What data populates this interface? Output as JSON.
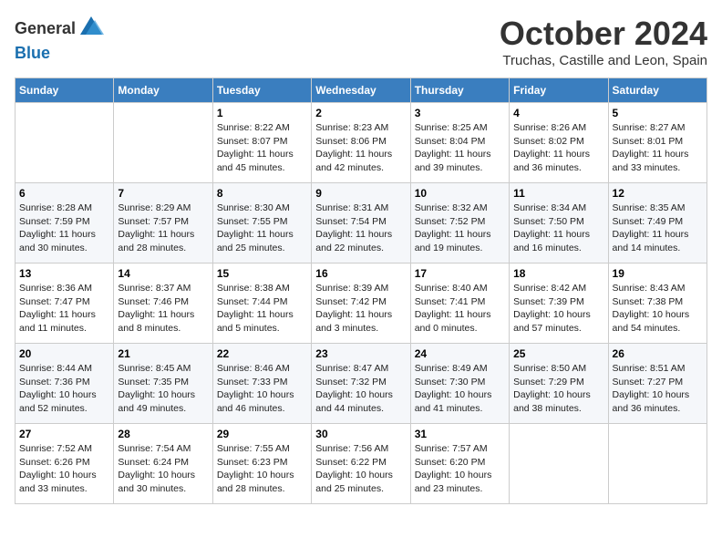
{
  "header": {
    "logo_line1": "General",
    "logo_line2": "Blue",
    "month": "October 2024",
    "location": "Truchas, Castille and Leon, Spain"
  },
  "days_of_week": [
    "Sunday",
    "Monday",
    "Tuesday",
    "Wednesday",
    "Thursday",
    "Friday",
    "Saturday"
  ],
  "weeks": [
    [
      {
        "day": "",
        "info": ""
      },
      {
        "day": "",
        "info": ""
      },
      {
        "day": "1",
        "info": "Sunrise: 8:22 AM\nSunset: 8:07 PM\nDaylight: 11 hours and 45 minutes."
      },
      {
        "day": "2",
        "info": "Sunrise: 8:23 AM\nSunset: 8:06 PM\nDaylight: 11 hours and 42 minutes."
      },
      {
        "day": "3",
        "info": "Sunrise: 8:25 AM\nSunset: 8:04 PM\nDaylight: 11 hours and 39 minutes."
      },
      {
        "day": "4",
        "info": "Sunrise: 8:26 AM\nSunset: 8:02 PM\nDaylight: 11 hours and 36 minutes."
      },
      {
        "day": "5",
        "info": "Sunrise: 8:27 AM\nSunset: 8:01 PM\nDaylight: 11 hours and 33 minutes."
      }
    ],
    [
      {
        "day": "6",
        "info": "Sunrise: 8:28 AM\nSunset: 7:59 PM\nDaylight: 11 hours and 30 minutes."
      },
      {
        "day": "7",
        "info": "Sunrise: 8:29 AM\nSunset: 7:57 PM\nDaylight: 11 hours and 28 minutes."
      },
      {
        "day": "8",
        "info": "Sunrise: 8:30 AM\nSunset: 7:55 PM\nDaylight: 11 hours and 25 minutes."
      },
      {
        "day": "9",
        "info": "Sunrise: 8:31 AM\nSunset: 7:54 PM\nDaylight: 11 hours and 22 minutes."
      },
      {
        "day": "10",
        "info": "Sunrise: 8:32 AM\nSunset: 7:52 PM\nDaylight: 11 hours and 19 minutes."
      },
      {
        "day": "11",
        "info": "Sunrise: 8:34 AM\nSunset: 7:50 PM\nDaylight: 11 hours and 16 minutes."
      },
      {
        "day": "12",
        "info": "Sunrise: 8:35 AM\nSunset: 7:49 PM\nDaylight: 11 hours and 14 minutes."
      }
    ],
    [
      {
        "day": "13",
        "info": "Sunrise: 8:36 AM\nSunset: 7:47 PM\nDaylight: 11 hours and 11 minutes."
      },
      {
        "day": "14",
        "info": "Sunrise: 8:37 AM\nSunset: 7:46 PM\nDaylight: 11 hours and 8 minutes."
      },
      {
        "day": "15",
        "info": "Sunrise: 8:38 AM\nSunset: 7:44 PM\nDaylight: 11 hours and 5 minutes."
      },
      {
        "day": "16",
        "info": "Sunrise: 8:39 AM\nSunset: 7:42 PM\nDaylight: 11 hours and 3 minutes."
      },
      {
        "day": "17",
        "info": "Sunrise: 8:40 AM\nSunset: 7:41 PM\nDaylight: 11 hours and 0 minutes."
      },
      {
        "day": "18",
        "info": "Sunrise: 8:42 AM\nSunset: 7:39 PM\nDaylight: 10 hours and 57 minutes."
      },
      {
        "day": "19",
        "info": "Sunrise: 8:43 AM\nSunset: 7:38 PM\nDaylight: 10 hours and 54 minutes."
      }
    ],
    [
      {
        "day": "20",
        "info": "Sunrise: 8:44 AM\nSunset: 7:36 PM\nDaylight: 10 hours and 52 minutes."
      },
      {
        "day": "21",
        "info": "Sunrise: 8:45 AM\nSunset: 7:35 PM\nDaylight: 10 hours and 49 minutes."
      },
      {
        "day": "22",
        "info": "Sunrise: 8:46 AM\nSunset: 7:33 PM\nDaylight: 10 hours and 46 minutes."
      },
      {
        "day": "23",
        "info": "Sunrise: 8:47 AM\nSunset: 7:32 PM\nDaylight: 10 hours and 44 minutes."
      },
      {
        "day": "24",
        "info": "Sunrise: 8:49 AM\nSunset: 7:30 PM\nDaylight: 10 hours and 41 minutes."
      },
      {
        "day": "25",
        "info": "Sunrise: 8:50 AM\nSunset: 7:29 PM\nDaylight: 10 hours and 38 minutes."
      },
      {
        "day": "26",
        "info": "Sunrise: 8:51 AM\nSunset: 7:27 PM\nDaylight: 10 hours and 36 minutes."
      }
    ],
    [
      {
        "day": "27",
        "info": "Sunrise: 7:52 AM\nSunset: 6:26 PM\nDaylight: 10 hours and 33 minutes."
      },
      {
        "day": "28",
        "info": "Sunrise: 7:54 AM\nSunset: 6:24 PM\nDaylight: 10 hours and 30 minutes."
      },
      {
        "day": "29",
        "info": "Sunrise: 7:55 AM\nSunset: 6:23 PM\nDaylight: 10 hours and 28 minutes."
      },
      {
        "day": "30",
        "info": "Sunrise: 7:56 AM\nSunset: 6:22 PM\nDaylight: 10 hours and 25 minutes."
      },
      {
        "day": "31",
        "info": "Sunrise: 7:57 AM\nSunset: 6:20 PM\nDaylight: 10 hours and 23 minutes."
      },
      {
        "day": "",
        "info": ""
      },
      {
        "day": "",
        "info": ""
      }
    ]
  ]
}
